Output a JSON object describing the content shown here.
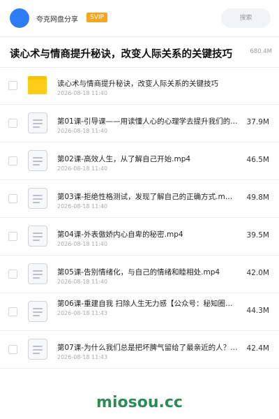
{
  "header": {
    "brand": "夸克网盘分享",
    "badge": "SVIP",
    "search_placeholder": "搜索"
  },
  "title_bar": {
    "title": "读心术与情商提升秘诀，改变人际关系的关键技巧",
    "total_size": "680.4M"
  },
  "files": [
    {
      "icon": "folder-icon",
      "name": "读心术与情商提升秘诀，改变人际关系的关键技巧",
      "date": "2026-08-18 11:40",
      "size": ""
    },
    {
      "icon": "file-icon",
      "name": "第01课-引导课——用读懂人心的心理学去提升我们的…",
      "date": "2026-08-18 11:40",
      "size": "37.9M"
    },
    {
      "icon": "file-icon",
      "name": "第02课-高效人生，从了解自己开始.mp4",
      "date": "2026-08-18 11:40",
      "size": "46.5M"
    },
    {
      "icon": "file-icon",
      "name": "第03课-拒绝性格测试，发现了解自己的正确方式.m…",
      "date": "2026-08-18 11:40",
      "size": "49.8M"
    },
    {
      "icon": "file-icon",
      "name": "第04课-外表傲娇内心自卑的秘密.mp4",
      "date": "2026-08-18 11:40",
      "size": "39.5M"
    },
    {
      "icon": "file-icon",
      "name": "第05课-告别情绪化，与自己的情绪和睦相处.mp4",
      "date": "2026-08-18 11:40",
      "size": "42.0M"
    },
    {
      "icon": "file-icon",
      "name": "第06课-重建自我 扫除人生无力感【公众号：秘知圈…",
      "date": "2026-08-18 11:43",
      "size": "44.3M"
    },
    {
      "icon": "file-icon",
      "name": "第07课-为什么我们总是把坏脾气留给了最亲近的人？…",
      "date": "2026-08-18 11:43",
      "size": "42.4M"
    }
  ],
  "watermark": "miosou.cc",
  "colors": {
    "accent": "#2f7df6",
    "badge": "#f5a623",
    "folder": "#ffcc17",
    "watermark": "#2e8b57"
  }
}
